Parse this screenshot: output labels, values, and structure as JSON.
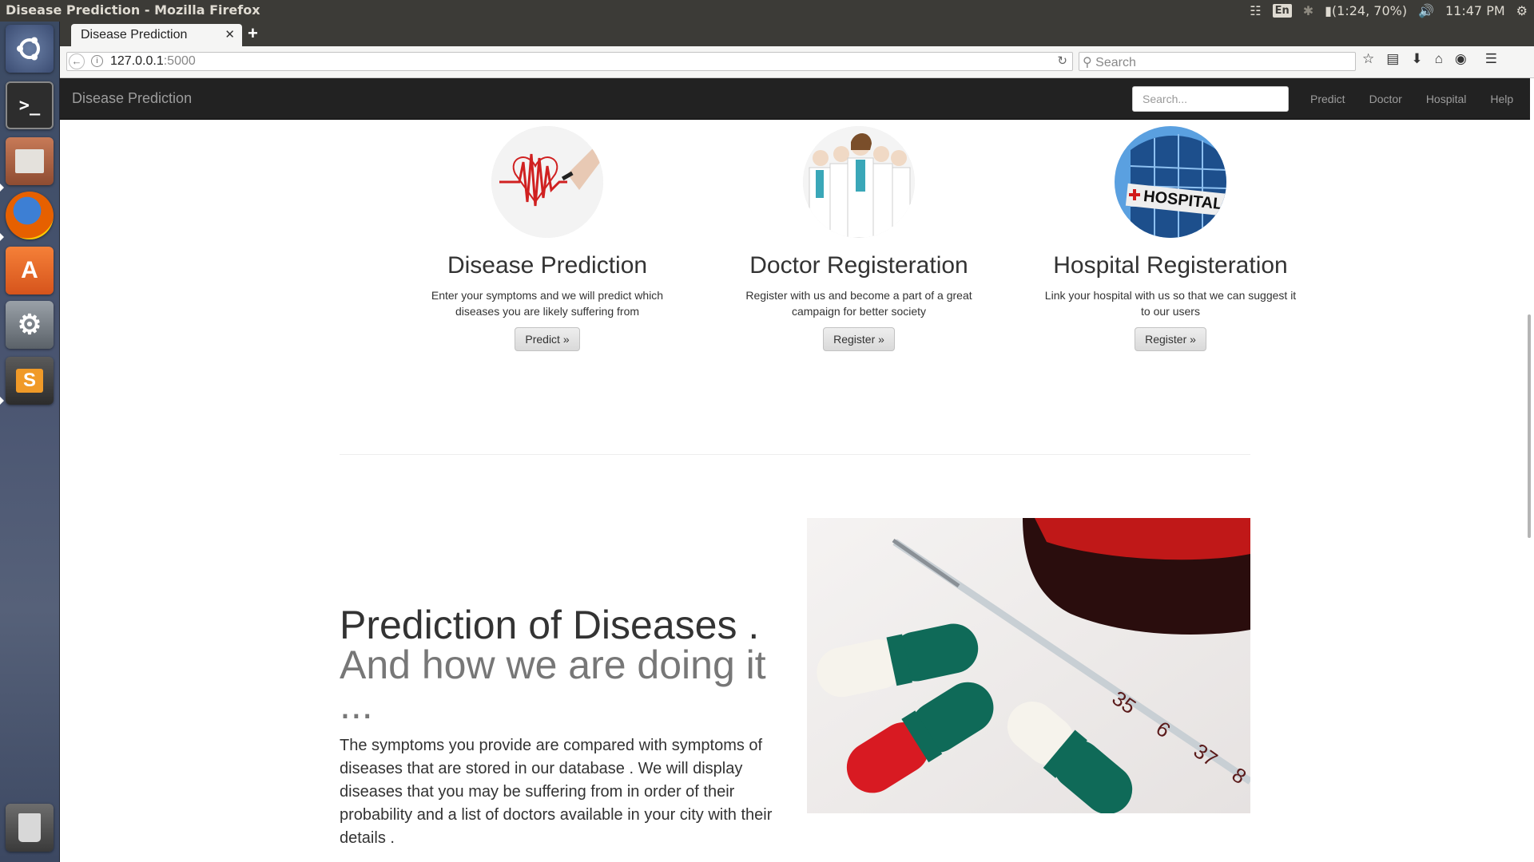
{
  "os": {
    "window_title": "Disease Prediction - Mozilla Firefox",
    "keyboard": "En",
    "battery": "(1:24, 70%)",
    "clock": "11:47 PM"
  },
  "launcher": {
    "items": [
      "ubuntu-dash",
      "terminal",
      "files",
      "firefox",
      "software-center",
      "system-settings",
      "sublime-text",
      "trash"
    ]
  },
  "browser": {
    "tab_title": "Disease Prediction",
    "url_host": "127.0.0.1",
    "url_port": ":5000",
    "search_placeholder": "Search"
  },
  "site": {
    "brand": "Disease Prediction",
    "search_placeholder": "Search...",
    "nav": [
      "Predict",
      "Doctor",
      "Hospital",
      "Help"
    ]
  },
  "features": [
    {
      "title": "Disease Prediction",
      "text": "Enter your symptoms and we will predict which diseases you are likely suffering from",
      "button": "Predict »"
    },
    {
      "title": "Doctor Registeration",
      "text": "Register with us and become a part of a great campaign for better society",
      "button": "Register »"
    },
    {
      "title": "Hospital Registeration",
      "text": "Link your hospital with us so that we can suggest it to our users",
      "button": "Register »"
    }
  ],
  "featurette": {
    "heading": "Prediction of Diseases .",
    "heading_muted": "And how we are doing it ...",
    "text": "The symptoms you provide are compared with symptoms of diseases that are stored in our database . We will display diseases that you may be suffering from in order of their probability and a list of doctors available in your city with their details .",
    "hospital_sign": "HOSPITAL",
    "thermo_labels": [
      "35",
      "6",
      "37",
      "8"
    ]
  }
}
